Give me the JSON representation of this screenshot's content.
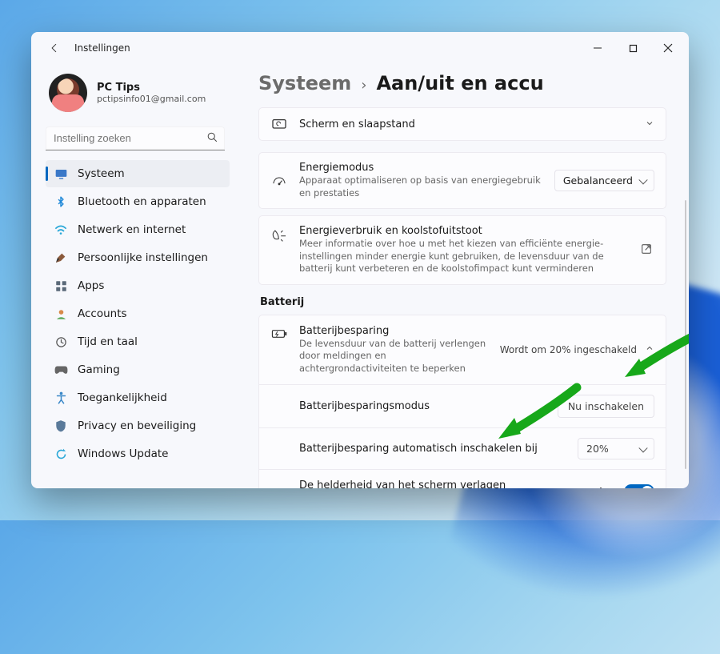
{
  "titlebar": {
    "title": "Instellingen"
  },
  "profile": {
    "name": "PC Tips",
    "email": "pctipsinfo01@gmail.com"
  },
  "search": {
    "placeholder": "Instelling zoeken"
  },
  "sidebar": {
    "items": [
      {
        "label": "Systeem",
        "icon": "system"
      },
      {
        "label": "Bluetooth en apparaten",
        "icon": "bluetooth"
      },
      {
        "label": "Netwerk en internet",
        "icon": "network"
      },
      {
        "label": "Persoonlijke instellingen",
        "icon": "personalization"
      },
      {
        "label": "Apps",
        "icon": "apps"
      },
      {
        "label": "Accounts",
        "icon": "accounts"
      },
      {
        "label": "Tijd en taal",
        "icon": "time"
      },
      {
        "label": "Gaming",
        "icon": "gaming"
      },
      {
        "label": "Toegankelijkheid",
        "icon": "accessibility"
      },
      {
        "label": "Privacy en beveiliging",
        "icon": "privacy"
      },
      {
        "label": "Windows Update",
        "icon": "update"
      }
    ]
  },
  "breadcrumb": {
    "parent": "Systeem",
    "current": "Aan/uit en accu"
  },
  "cards": {
    "screen_sleep": {
      "title": "Scherm en slaapstand"
    },
    "power_mode": {
      "title": "Energiemodus",
      "desc": "Apparaat optimaliseren op basis van energiegebruik en prestaties",
      "value": "Gebalanceerd"
    },
    "energy_info": {
      "title": "Energieverbruik en koolstofuitstoot",
      "desc": "Meer informatie over hoe u met het kiezen van efficiënte energie-instellingen minder energie kunt gebruiken, de levensduur van de batterij kunt verbeteren en de koolstofimpact kunt verminderen"
    }
  },
  "battery": {
    "header": "Batterij",
    "saver": {
      "title": "Batterijbesparing",
      "desc": "De levensduur van de batterij verlengen door meldingen en achtergrondactiviteiten te beperken",
      "status": "Wordt om 20% ingeschakeld"
    },
    "mode_row": {
      "title": "Batterijbesparingsmodus",
      "button": "Nu inschakelen"
    },
    "auto_row": {
      "title": "Batterijbesparing automatisch inschakelen bij",
      "value": "20%"
    },
    "brightness_row": {
      "title": "De helderheid van het scherm verlagen wanneer batterijbesparing wordt gebruikt",
      "state": "Aan"
    }
  },
  "colors": {
    "accent": "#0067c0",
    "arrow": "#17a81a"
  }
}
